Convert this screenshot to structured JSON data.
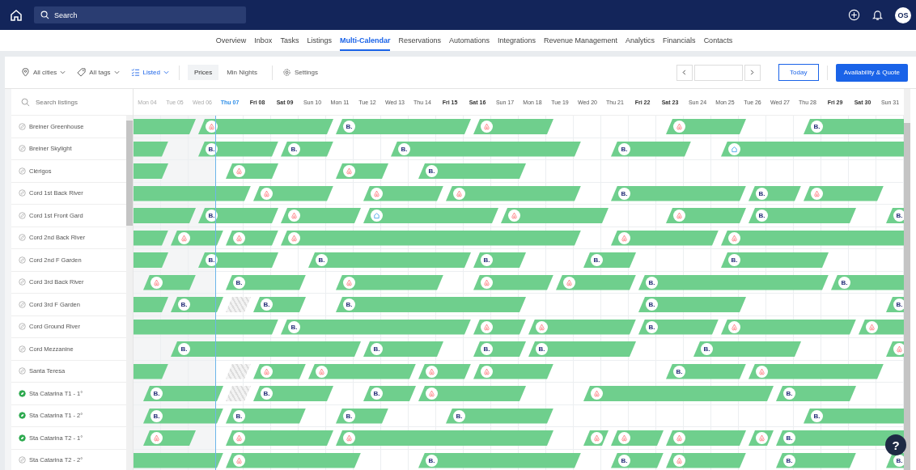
{
  "topbar": {
    "search": {
      "placeholder": "Search"
    },
    "avatar": "OS"
  },
  "nav": [
    {
      "label": "Overview",
      "selected": false
    },
    {
      "label": "Inbox",
      "selected": false
    },
    {
      "label": "Tasks",
      "selected": false
    },
    {
      "label": "Listings",
      "selected": false
    },
    {
      "label": "Multi-Calendar",
      "selected": true
    },
    {
      "label": "Reservations",
      "selected": false
    },
    {
      "label": "Automations",
      "selected": false
    },
    {
      "label": "Integrations",
      "selected": false
    },
    {
      "label": "Revenue Management",
      "selected": false
    },
    {
      "label": "Analytics",
      "selected": false
    },
    {
      "label": "Financials",
      "selected": false
    },
    {
      "label": "Contacts",
      "selected": false
    }
  ],
  "toolbar": {
    "filters": [
      {
        "kind": "location",
        "label": "All cities",
        "active": false
      },
      {
        "kind": "tag",
        "label": "All tags",
        "active": false
      },
      {
        "kind": "status",
        "label": "Listed",
        "active": true
      }
    ],
    "view_toggle": [
      {
        "label": "Prices",
        "selected": true
      },
      {
        "label": "Min Nights",
        "selected": false
      }
    ],
    "settings": "Settings",
    "today": "Today",
    "primary": "Availability & Quote"
  },
  "sidebar": {
    "search": {
      "placeholder": "Search listings"
    }
  },
  "days": [
    {
      "label": "Mon 04",
      "kind": "past"
    },
    {
      "label": "Tue 05",
      "kind": "past"
    },
    {
      "label": "Wed 06",
      "kind": "past"
    },
    {
      "label": "Thu 07",
      "kind": "today"
    },
    {
      "label": "Fri 08",
      "kind": "weekend"
    },
    {
      "label": "Sat 09",
      "kind": "weekend"
    },
    {
      "label": "Sun 10",
      "kind": "normal"
    },
    {
      "label": "Mon 11",
      "kind": "normal"
    },
    {
      "label": "Tue 12",
      "kind": "normal"
    },
    {
      "label": "Wed 13",
      "kind": "normal"
    },
    {
      "label": "Thu 14",
      "kind": "normal"
    },
    {
      "label": "Fri 15",
      "kind": "weekend"
    },
    {
      "label": "Sat 16",
      "kind": "weekend"
    },
    {
      "label": "Sun 17",
      "kind": "normal"
    },
    {
      "label": "Mon 18",
      "kind": "normal"
    },
    {
      "label": "Tue 19",
      "kind": "normal"
    },
    {
      "label": "Wed 20",
      "kind": "normal"
    },
    {
      "label": "Thu 21",
      "kind": "normal"
    },
    {
      "label": "Fri 22",
      "kind": "weekend"
    },
    {
      "label": "Sat 23",
      "kind": "weekend"
    },
    {
      "label": "Sun 24",
      "kind": "normal"
    },
    {
      "label": "Mon 25",
      "kind": "normal"
    },
    {
      "label": "Tue 26",
      "kind": "normal"
    },
    {
      "label": "Wed 27",
      "kind": "normal"
    },
    {
      "label": "Thu 28",
      "kind": "normal"
    },
    {
      "label": "Fri 29",
      "kind": "weekend"
    },
    {
      "label": "Sat 30",
      "kind": "weekend"
    },
    {
      "label": "Sun 31",
      "kind": "normal"
    }
  ],
  "listings": [
    {
      "name": "Breiner Greenhouse",
      "connected": false,
      "cells": [
        {
          "kind": "stay"
        },
        {
          "kind": "stay"
        },
        {
          "kind": "airbnb"
        },
        {
          "kind": "stay"
        },
        {
          "kind": "stay"
        },
        {
          "kind": "stay"
        },
        {
          "kind": "stay"
        },
        {
          "kind": "booking",
          "badge": "B."
        },
        {
          "kind": "stay"
        },
        {
          "kind": "stay"
        },
        {
          "kind": "stay"
        },
        {
          "kind": "stay"
        },
        {
          "kind": "airbnb"
        },
        {
          "kind": "stay"
        },
        {
          "kind": "stay"
        },
        {
          "kind": "free"
        },
        {
          "kind": "free"
        },
        {
          "kind": "free"
        },
        {
          "kind": "free"
        },
        {
          "kind": "airbnb"
        },
        {
          "kind": "stay"
        },
        {
          "kind": "stay"
        },
        {
          "kind": "free"
        },
        {
          "kind": "free"
        },
        {
          "kind": "booking",
          "badge": "B."
        },
        {
          "kind": "stay"
        },
        {
          "kind": "stay"
        },
        {
          "kind": "stay"
        }
      ]
    },
    {
      "name": "Breiner Skylight",
      "connected": false,
      "cells": [
        {
          "kind": "stay"
        },
        {
          "kind": "free"
        },
        {
          "kind": "booking",
          "badge": "B."
        },
        {
          "kind": "stay"
        },
        {
          "kind": "stay"
        },
        {
          "kind": "booking",
          "badge": "B."
        },
        {
          "kind": "stay"
        },
        {
          "kind": "free"
        },
        {
          "kind": "free"
        },
        {
          "kind": "booking",
          "badge": "B."
        },
        {
          "kind": "stay"
        },
        {
          "kind": "stay"
        },
        {
          "kind": "stay"
        },
        {
          "kind": "stay"
        },
        {
          "kind": "stay"
        },
        {
          "kind": "stay"
        },
        {
          "kind": "free"
        },
        {
          "kind": "booking",
          "badge": "B."
        },
        {
          "kind": "stay"
        },
        {
          "kind": "stay"
        },
        {
          "kind": "free"
        },
        {
          "kind": "direct"
        },
        {
          "kind": "stay"
        },
        {
          "kind": "stay"
        },
        {
          "kind": "stay"
        },
        {
          "kind": "stay"
        },
        {
          "kind": "stay"
        },
        {
          "kind": "stay"
        }
      ]
    },
    {
      "name": "Clérigos",
      "connected": false,
      "cells": [
        {
          "kind": "stay"
        },
        {
          "kind": "free"
        },
        {
          "kind": "free"
        },
        {
          "kind": "airbnb"
        },
        {
          "kind": "stay"
        },
        {
          "kind": "free"
        },
        {
          "kind": "free"
        },
        {
          "kind": "airbnb"
        },
        {
          "kind": "stay"
        },
        {
          "kind": "free"
        },
        {
          "kind": "booking",
          "badge": "B."
        },
        {
          "kind": "stay"
        },
        {
          "kind": "stay"
        },
        {
          "kind": "stay"
        },
        {
          "kind": "free"
        },
        {
          "kind": "free"
        },
        {
          "kind": "free"
        },
        {
          "kind": "free"
        },
        {
          "kind": "free"
        },
        {
          "kind": "free"
        },
        {
          "kind": "free"
        },
        {
          "kind": "free"
        },
        {
          "kind": "free"
        },
        {
          "kind": "free"
        },
        {
          "kind": "free"
        },
        {
          "kind": "free"
        },
        {
          "kind": "free"
        },
        {
          "kind": "free"
        }
      ]
    },
    {
      "name": "Cord 1st Back River",
      "connected": false,
      "cells": [
        {
          "kind": "stay"
        },
        {
          "kind": "stay"
        },
        {
          "kind": "stay"
        },
        {
          "kind": "stay"
        },
        {
          "kind": "airbnb"
        },
        {
          "kind": "stay"
        },
        {
          "kind": "stay"
        },
        {
          "kind": "free"
        },
        {
          "kind": "airbnb"
        },
        {
          "kind": "stay"
        },
        {
          "kind": "stay"
        },
        {
          "kind": "airbnb"
        },
        {
          "kind": "stay"
        },
        {
          "kind": "stay"
        },
        {
          "kind": "stay"
        },
        {
          "kind": "stay"
        },
        {
          "kind": "free"
        },
        {
          "kind": "booking",
          "badge": "B."
        },
        {
          "kind": "stay"
        },
        {
          "kind": "stay"
        },
        {
          "kind": "stay"
        },
        {
          "kind": "stay"
        },
        {
          "kind": "booking",
          "badge": "B."
        },
        {
          "kind": "stay"
        },
        {
          "kind": "airbnb"
        },
        {
          "kind": "stay"
        },
        {
          "kind": "stay"
        },
        {
          "kind": "free"
        }
      ]
    },
    {
      "name": "Cord 1st Front Gard",
      "connected": false,
      "cells": [
        {
          "kind": "stay"
        },
        {
          "kind": "stay"
        },
        {
          "kind": "booking",
          "badge": "B."
        },
        {
          "kind": "stay"
        },
        {
          "kind": "stay"
        },
        {
          "kind": "airbnb"
        },
        {
          "kind": "stay"
        },
        {
          "kind": "stay"
        },
        {
          "kind": "direct"
        },
        {
          "kind": "stay"
        },
        {
          "kind": "stay"
        },
        {
          "kind": "stay"
        },
        {
          "kind": "stay"
        },
        {
          "kind": "airbnb"
        },
        {
          "kind": "stay"
        },
        {
          "kind": "stay"
        },
        {
          "kind": "stay"
        },
        {
          "kind": "free"
        },
        {
          "kind": "free"
        },
        {
          "kind": "airbnb"
        },
        {
          "kind": "stay"
        },
        {
          "kind": "stay"
        },
        {
          "kind": "booking",
          "badge": "B."
        },
        {
          "kind": "stay"
        },
        {
          "kind": "stay"
        },
        {
          "kind": "stay"
        },
        {
          "kind": "free"
        },
        {
          "kind": "booking",
          "badge": "B."
        }
      ]
    },
    {
      "name": "Cord 2nd Back River",
      "connected": false,
      "cells": [
        {
          "kind": "stay"
        },
        {
          "kind": "airbnb"
        },
        {
          "kind": "stay"
        },
        {
          "kind": "airbnb"
        },
        {
          "kind": "stay"
        },
        {
          "kind": "airbnb"
        },
        {
          "kind": "stay"
        },
        {
          "kind": "stay"
        },
        {
          "kind": "stay"
        },
        {
          "kind": "stay"
        },
        {
          "kind": "stay"
        },
        {
          "kind": "stay"
        },
        {
          "kind": "stay"
        },
        {
          "kind": "stay"
        },
        {
          "kind": "stay"
        },
        {
          "kind": "stay"
        },
        {
          "kind": "free"
        },
        {
          "kind": "airbnb"
        },
        {
          "kind": "stay"
        },
        {
          "kind": "stay"
        },
        {
          "kind": "stay"
        },
        {
          "kind": "airbnb"
        },
        {
          "kind": "stay"
        },
        {
          "kind": "stay"
        },
        {
          "kind": "stay"
        },
        {
          "kind": "stay"
        },
        {
          "kind": "stay"
        },
        {
          "kind": "stay"
        }
      ]
    },
    {
      "name": "Cord 2nd F Garden",
      "connected": false,
      "cells": [
        {
          "kind": "stay"
        },
        {
          "kind": "free"
        },
        {
          "kind": "booking",
          "badge": "B."
        },
        {
          "kind": "stay"
        },
        {
          "kind": "stay"
        },
        {
          "kind": "free"
        },
        {
          "kind": "booking",
          "badge": "B."
        },
        {
          "kind": "stay"
        },
        {
          "kind": "stay"
        },
        {
          "kind": "stay"
        },
        {
          "kind": "stay"
        },
        {
          "kind": "stay"
        },
        {
          "kind": "booking",
          "badge": "B."
        },
        {
          "kind": "stay"
        },
        {
          "kind": "free"
        },
        {
          "kind": "free"
        },
        {
          "kind": "booking",
          "badge": "B."
        },
        {
          "kind": "stay"
        },
        {
          "kind": "free"
        },
        {
          "kind": "free"
        },
        {
          "kind": "free"
        },
        {
          "kind": "booking",
          "badge": "B."
        },
        {
          "kind": "stay"
        },
        {
          "kind": "stay"
        },
        {
          "kind": "stay"
        },
        {
          "kind": "free"
        },
        {
          "kind": "free"
        },
        {
          "kind": "free"
        }
      ]
    },
    {
      "name": "Cord 3rd Back River",
      "connected": false,
      "cells": [
        {
          "kind": "airbnb"
        },
        {
          "kind": "stay"
        },
        {
          "kind": "free"
        },
        {
          "kind": "booking",
          "badge": "B."
        },
        {
          "kind": "stay"
        },
        {
          "kind": "stay"
        },
        {
          "kind": "free"
        },
        {
          "kind": "airbnb"
        },
        {
          "kind": "stay"
        },
        {
          "kind": "stay"
        },
        {
          "kind": "stay"
        },
        {
          "kind": "free"
        },
        {
          "kind": "airbnb"
        },
        {
          "kind": "stay"
        },
        {
          "kind": "stay"
        },
        {
          "kind": "airbnb"
        },
        {
          "kind": "stay"
        },
        {
          "kind": "stay"
        },
        {
          "kind": "booking",
          "badge": "B."
        },
        {
          "kind": "stay"
        },
        {
          "kind": "stay"
        },
        {
          "kind": "stay"
        },
        {
          "kind": "stay"
        },
        {
          "kind": "stay"
        },
        {
          "kind": "stay"
        },
        {
          "kind": "booking",
          "badge": "B."
        },
        {
          "kind": "stay"
        },
        {
          "kind": "stay"
        }
      ]
    },
    {
      "name": "Cord 3rd F Garden",
      "connected": false,
      "cells": [
        {
          "kind": "stay"
        },
        {
          "kind": "booking",
          "badge": "B."
        },
        {
          "kind": "stay"
        },
        {
          "kind": "blocked"
        },
        {
          "kind": "booking",
          "badge": "B."
        },
        {
          "kind": "stay"
        },
        {
          "kind": "free"
        },
        {
          "kind": "booking",
          "badge": "B."
        },
        {
          "kind": "stay"
        },
        {
          "kind": "stay"
        },
        {
          "kind": "stay"
        },
        {
          "kind": "stay"
        },
        {
          "kind": "stay"
        },
        {
          "kind": "stay"
        },
        {
          "kind": "free"
        },
        {
          "kind": "free"
        },
        {
          "kind": "free"
        },
        {
          "kind": "free"
        },
        {
          "kind": "booking",
          "badge": "B."
        },
        {
          "kind": "stay"
        },
        {
          "kind": "stay"
        },
        {
          "kind": "stay"
        },
        {
          "kind": "free"
        },
        {
          "kind": "free"
        },
        {
          "kind": "free"
        },
        {
          "kind": "free"
        },
        {
          "kind": "free"
        },
        {
          "kind": "booking",
          "badge": "B."
        }
      ]
    },
    {
      "name": "Cord Ground River",
      "connected": false,
      "cells": [
        {
          "kind": "stay"
        },
        {
          "kind": "stay"
        },
        {
          "kind": "stay"
        },
        {
          "kind": "stay"
        },
        {
          "kind": "stay"
        },
        {
          "kind": "booking",
          "badge": "B."
        },
        {
          "kind": "stay"
        },
        {
          "kind": "stay"
        },
        {
          "kind": "stay"
        },
        {
          "kind": "stay"
        },
        {
          "kind": "stay"
        },
        {
          "kind": "stay"
        },
        {
          "kind": "airbnb"
        },
        {
          "kind": "stay"
        },
        {
          "kind": "airbnb"
        },
        {
          "kind": "stay"
        },
        {
          "kind": "stay"
        },
        {
          "kind": "stay"
        },
        {
          "kind": "booking",
          "badge": "B."
        },
        {
          "kind": "stay"
        },
        {
          "kind": "stay"
        },
        {
          "kind": "airbnb"
        },
        {
          "kind": "stay"
        },
        {
          "kind": "stay"
        },
        {
          "kind": "stay"
        },
        {
          "kind": "stay"
        },
        {
          "kind": "airbnb"
        },
        {
          "kind": "stay"
        }
      ]
    },
    {
      "name": "Cord Mezzanine",
      "connected": false,
      "cells": [
        {
          "kind": "free"
        },
        {
          "kind": "booking",
          "badge": "B."
        },
        {
          "kind": "stay"
        },
        {
          "kind": "stay"
        },
        {
          "kind": "stay"
        },
        {
          "kind": "stay"
        },
        {
          "kind": "stay"
        },
        {
          "kind": "stay"
        },
        {
          "kind": "booking",
          "badge": "B."
        },
        {
          "kind": "stay"
        },
        {
          "kind": "stay"
        },
        {
          "kind": "free"
        },
        {
          "kind": "booking",
          "badge": "B."
        },
        {
          "kind": "stay"
        },
        {
          "kind": "booking",
          "badge": "B."
        },
        {
          "kind": "stay"
        },
        {
          "kind": "stay"
        },
        {
          "kind": "stay"
        },
        {
          "kind": "free"
        },
        {
          "kind": "free"
        },
        {
          "kind": "booking",
          "badge": "B."
        },
        {
          "kind": "stay"
        },
        {
          "kind": "stay"
        },
        {
          "kind": "stay"
        },
        {
          "kind": "free"
        },
        {
          "kind": "free"
        },
        {
          "kind": "free"
        },
        {
          "kind": "airbnb"
        }
      ]
    },
    {
      "name": "Santa Teresa",
      "connected": false,
      "cells": [
        {
          "kind": "stay"
        },
        {
          "kind": "free"
        },
        {
          "kind": "free"
        },
        {
          "kind": "blocked"
        },
        {
          "kind": "airbnb"
        },
        {
          "kind": "stay"
        },
        {
          "kind": "airbnb"
        },
        {
          "kind": "stay"
        },
        {
          "kind": "stay"
        },
        {
          "kind": "stay"
        },
        {
          "kind": "airbnb"
        },
        {
          "kind": "stay"
        },
        {
          "kind": "airbnb"
        },
        {
          "kind": "stay"
        },
        {
          "kind": "stay"
        },
        {
          "kind": "free"
        },
        {
          "kind": "free"
        },
        {
          "kind": "free"
        },
        {
          "kind": "free"
        },
        {
          "kind": "booking",
          "badge": "B."
        },
        {
          "kind": "stay"
        },
        {
          "kind": "stay"
        },
        {
          "kind": "airbnb"
        },
        {
          "kind": "stay"
        },
        {
          "kind": "stay"
        },
        {
          "kind": "stay"
        },
        {
          "kind": "stay"
        },
        {
          "kind": "free"
        }
      ]
    },
    {
      "name": "Sta Catarina T1 - 1°",
      "connected": true,
      "cells": [
        {
          "kind": "booking",
          "badge": "B."
        },
        {
          "kind": "stay"
        },
        {
          "kind": "stay"
        },
        {
          "kind": "blocked"
        },
        {
          "kind": "booking",
          "badge": "B."
        },
        {
          "kind": "stay"
        },
        {
          "kind": "stay"
        },
        {
          "kind": "free"
        },
        {
          "kind": "booking",
          "badge": "B."
        },
        {
          "kind": "stay"
        },
        {
          "kind": "airbnb"
        },
        {
          "kind": "stay"
        },
        {
          "kind": "stay"
        },
        {
          "kind": "stay"
        },
        {
          "kind": "free"
        },
        {
          "kind": "free"
        },
        {
          "kind": "airbnb"
        },
        {
          "kind": "stay"
        },
        {
          "kind": "stay"
        },
        {
          "kind": "stay"
        },
        {
          "kind": "stay"
        },
        {
          "kind": "stay"
        },
        {
          "kind": "stay"
        },
        {
          "kind": "booking",
          "badge": "B."
        },
        {
          "kind": "stay"
        },
        {
          "kind": "stay"
        },
        {
          "kind": "free"
        },
        {
          "kind": "free"
        }
      ]
    },
    {
      "name": "Sta Catarina T1 - 2°",
      "connected": true,
      "cells": [
        {
          "kind": "booking",
          "badge": "B."
        },
        {
          "kind": "stay"
        },
        {
          "kind": "stay"
        },
        {
          "kind": "booking",
          "badge": "B."
        },
        {
          "kind": "stay"
        },
        {
          "kind": "stay"
        },
        {
          "kind": "free"
        },
        {
          "kind": "booking",
          "badge": "B."
        },
        {
          "kind": "stay"
        },
        {
          "kind": "free"
        },
        {
          "kind": "free"
        },
        {
          "kind": "booking",
          "badge": "B."
        },
        {
          "kind": "stay"
        },
        {
          "kind": "stay"
        },
        {
          "kind": "stay"
        },
        {
          "kind": "free"
        },
        {
          "kind": "free"
        },
        {
          "kind": "free"
        },
        {
          "kind": "free"
        },
        {
          "kind": "free"
        },
        {
          "kind": "free"
        },
        {
          "kind": "free"
        },
        {
          "kind": "free"
        },
        {
          "kind": "free"
        },
        {
          "kind": "booking",
          "badge": "B."
        },
        {
          "kind": "stay"
        },
        {
          "kind": "stay"
        },
        {
          "kind": "stay"
        }
      ]
    },
    {
      "name": "Sta Catarina T2 - 1°",
      "connected": true,
      "cells": [
        {
          "kind": "airbnb"
        },
        {
          "kind": "stay"
        },
        {
          "kind": "free"
        },
        {
          "kind": "airbnb"
        },
        {
          "kind": "stay"
        },
        {
          "kind": "stay"
        },
        {
          "kind": "stay"
        },
        {
          "kind": "airbnb"
        },
        {
          "kind": "stay"
        },
        {
          "kind": "stay"
        },
        {
          "kind": "stay"
        },
        {
          "kind": "stay"
        },
        {
          "kind": "stay"
        },
        {
          "kind": "stay"
        },
        {
          "kind": "stay"
        },
        {
          "kind": "free"
        },
        {
          "kind": "airbnb"
        },
        {
          "kind": "airbnb"
        },
        {
          "kind": "stay"
        },
        {
          "kind": "airbnb"
        },
        {
          "kind": "stay"
        },
        {
          "kind": "stay"
        },
        {
          "kind": "airbnb"
        },
        {
          "kind": "booking",
          "badge": "B."
        },
        {
          "kind": "stay"
        },
        {
          "kind": "stay"
        },
        {
          "kind": "stay"
        },
        {
          "kind": "stay"
        }
      ]
    },
    {
      "name": "Sta Catarina T2 - 2°",
      "connected": false,
      "cells": [
        {
          "kind": "stay"
        },
        {
          "kind": "stay"
        },
        {
          "kind": "stay"
        },
        {
          "kind": "airbnb"
        },
        {
          "kind": "stay"
        },
        {
          "kind": "stay"
        },
        {
          "kind": "stay"
        },
        {
          "kind": "stay"
        },
        {
          "kind": "free"
        },
        {
          "kind": "free"
        },
        {
          "kind": "booking",
          "badge": "B."
        },
        {
          "kind": "stay"
        },
        {
          "kind": "stay"
        },
        {
          "kind": "stay"
        },
        {
          "kind": "stay"
        },
        {
          "kind": "stay"
        },
        {
          "kind": "free"
        },
        {
          "kind": "booking",
          "badge": "B."
        },
        {
          "kind": "stay"
        },
        {
          "kind": "airbnb"
        },
        {
          "kind": "stay"
        },
        {
          "kind": "stay"
        },
        {
          "kind": "free"
        },
        {
          "kind": "booking",
          "badge": "B."
        },
        {
          "kind": "stay"
        },
        {
          "kind": "stay"
        },
        {
          "kind": "free"
        },
        {
          "kind": "booking",
          "badge": "B."
        }
      ]
    }
  ],
  "help": "?"
}
